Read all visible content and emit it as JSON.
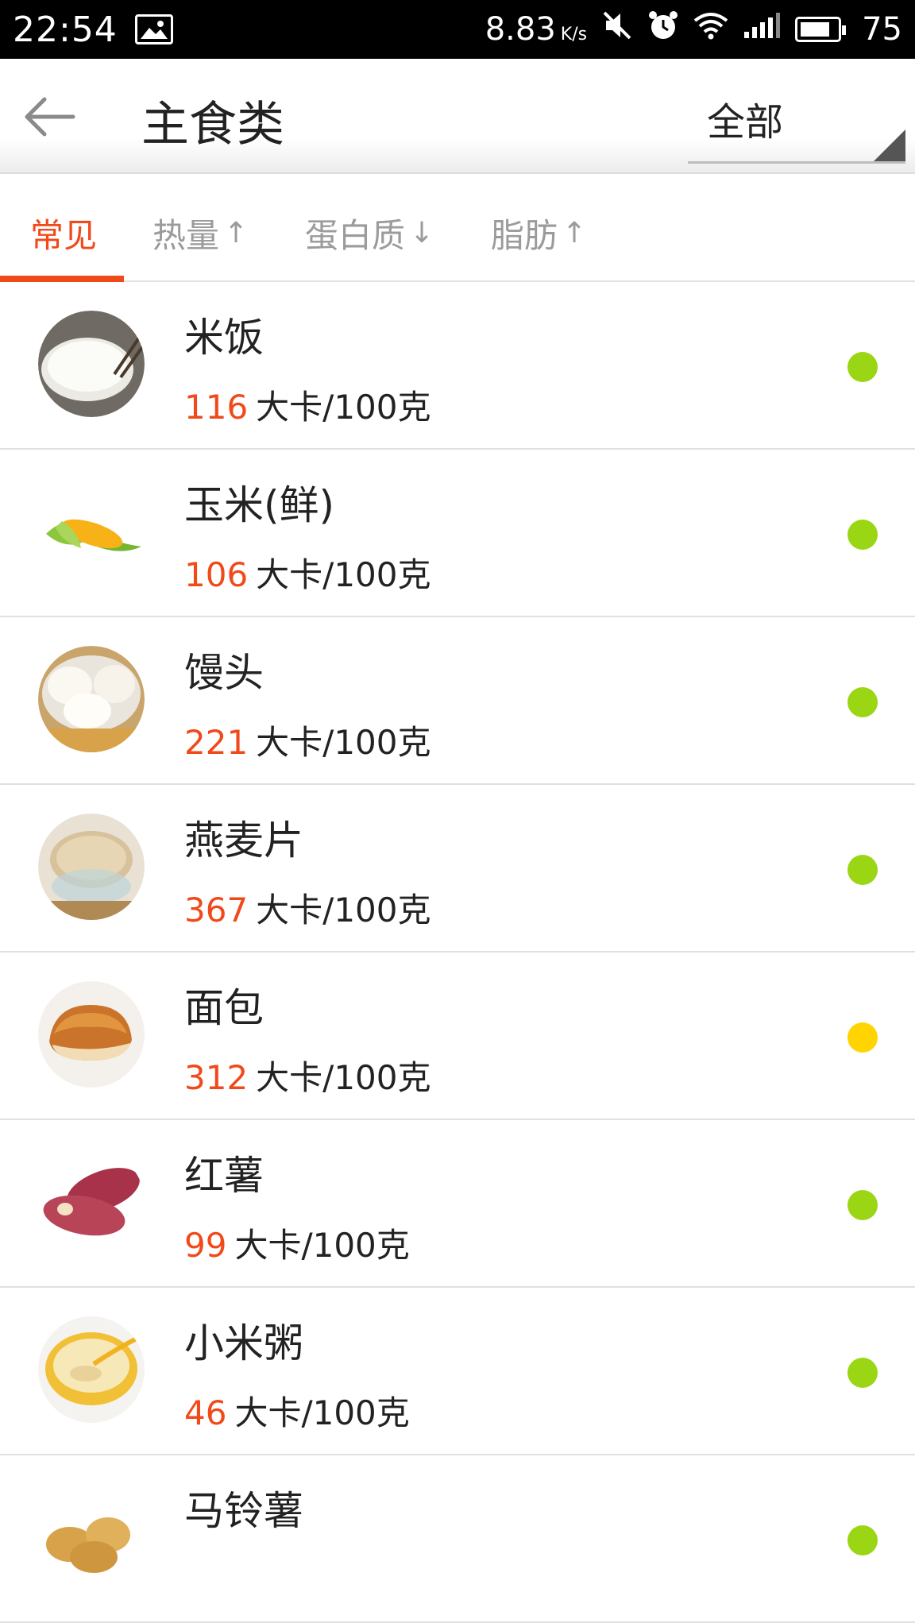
{
  "status_bar": {
    "time": "22:54",
    "speed_value": "8.83",
    "speed_unit": "K/s",
    "battery": "75"
  },
  "header": {
    "title": "主食类",
    "filter_label": "全部"
  },
  "tabs": [
    {
      "label": "常见",
      "arrow": "",
      "active": true
    },
    {
      "label": "热量",
      "arrow": "↑",
      "active": false
    },
    {
      "label": "蛋白质",
      "arrow": "↓",
      "active": false
    },
    {
      "label": "脂肪",
      "arrow": "↑",
      "active": false
    }
  ],
  "unit": "大卡/100克",
  "foods": [
    {
      "name": "米饭",
      "calories": "116",
      "indicator_color": "#9ad613"
    },
    {
      "name": "玉米(鲜)",
      "calories": "106",
      "indicator_color": "#9ad613"
    },
    {
      "name": "馒头",
      "calories": "221",
      "indicator_color": "#9ad613"
    },
    {
      "name": "燕麦片",
      "calories": "367",
      "indicator_color": "#9ad613"
    },
    {
      "name": "面包",
      "calories": "312",
      "indicator_color": "#ffd400"
    },
    {
      "name": "红薯",
      "calories": "99",
      "indicator_color": "#9ad613"
    },
    {
      "name": "小米粥",
      "calories": "46",
      "indicator_color": "#9ad613"
    },
    {
      "name": "马铃薯",
      "calories": "",
      "indicator_color": "#9ad613"
    }
  ],
  "colors": {
    "accent": "#f04a1b",
    "healthy": "#9ad613",
    "moderate": "#ffd400"
  }
}
